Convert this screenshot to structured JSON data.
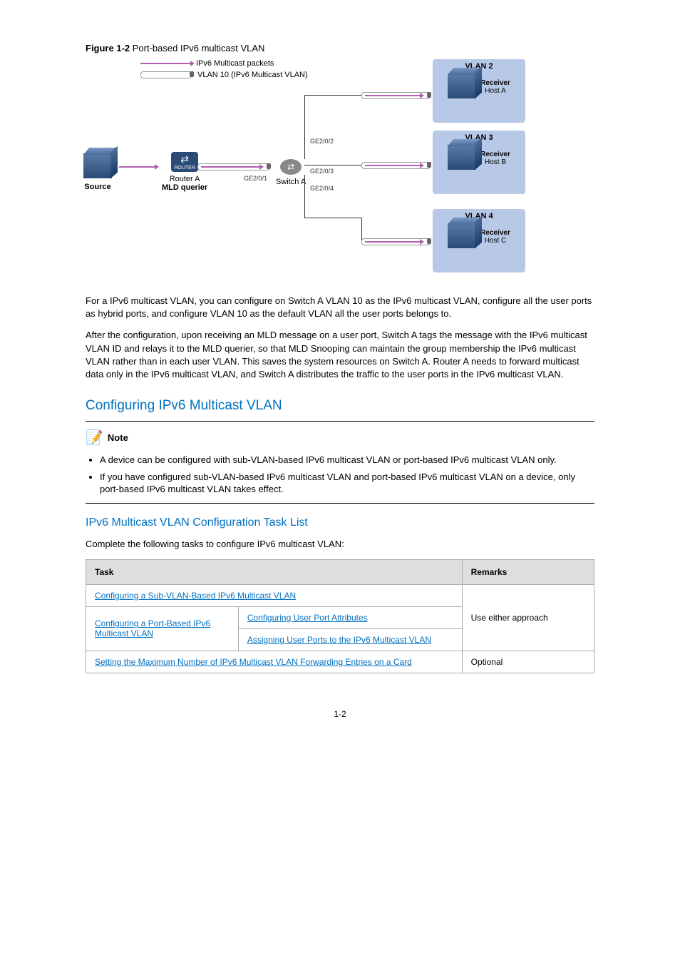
{
  "figure": {
    "number": "Figure 1-2",
    "caption": "Port-based IPv6 multicast VLAN",
    "legend1": "IPv6 Multicast packets",
    "legend2": "VLAN 10 (IPv6 Multicast VLAN)",
    "source": "Source",
    "routerA": "Router A",
    "mldQuerier": "MLD querier",
    "routerSub": "ROUTER",
    "switchA": "Switch A",
    "ge201": "GE2/0/1",
    "ge202": "GE2/0/2",
    "ge203": "GE2/0/3",
    "ge204": "GE2/0/4",
    "vlan2": "VLAN 2",
    "vlan3": "VLAN 3",
    "vlan4": "VLAN 4",
    "receiver": "Receiver",
    "hostA": "Host A",
    "hostB": "Host B",
    "hostC": "Host C"
  },
  "para1": "For a IPv6 multicast VLAN, you can configure on Switch A VLAN 10 as the IPv6 multicast VLAN, configure all the user ports as hybrid ports, and configure VLAN 10 as the default VLAN all the user ports belongs to.",
  "para2": "After the configuration, upon receiving an MLD message on a user port, Switch A tags the message with the IPv6 multicast VLAN ID and relays it to the MLD querier, so that MLD Snooping can maintain the group membership the IPv6 multicast VLAN rather than in each user VLAN. This saves the system resources on Switch A. Router A needs to forward multicast data only in the IPv6 multicast VLAN, and Switch A distributes the traffic to the user ports in the IPv6 multicast VLAN.",
  "sectionTitle": "Configuring IPv6 Multicast VLAN",
  "noteLabel": "Note",
  "noteItems": [
    "A device can be configured with sub-VLAN-based IPv6 multicast VLAN or port-based IPv6 multicast VLAN only.",
    "If you have configured sub-VLAN-based IPv6 multicast VLAN and port-based IPv6 multicast VLAN on a device, only port-based IPv6 multicast VLAN takes effect."
  ],
  "subsectionTitle": "IPv6 Multicast VLAN Configuration Task List",
  "tableIntro": "Complete the following tasks to configure IPv6 multicast VLAN:",
  "table": {
    "heads": [
      "Task",
      "Remarks"
    ],
    "row1": {
      "label": "Configuring a Sub-VLAN-Based IPv6 Multicast VLAN",
      "remark": ""
    },
    "row2": {
      "groupLabel": "Configuring a Port-Based IPv6 Multicast VLAN",
      "c1": "Configuring User Port Attributes",
      "c2": "Assigning User Ports to the IPv6 Multicast VLAN",
      "remarkMerged": "Use either approach"
    },
    "row3": {
      "label": "Setting the Maximum Number of IPv6 Multicast VLAN Forwarding Entries on a Card",
      "remark": "Optional"
    }
  },
  "pageNum": "1-2"
}
